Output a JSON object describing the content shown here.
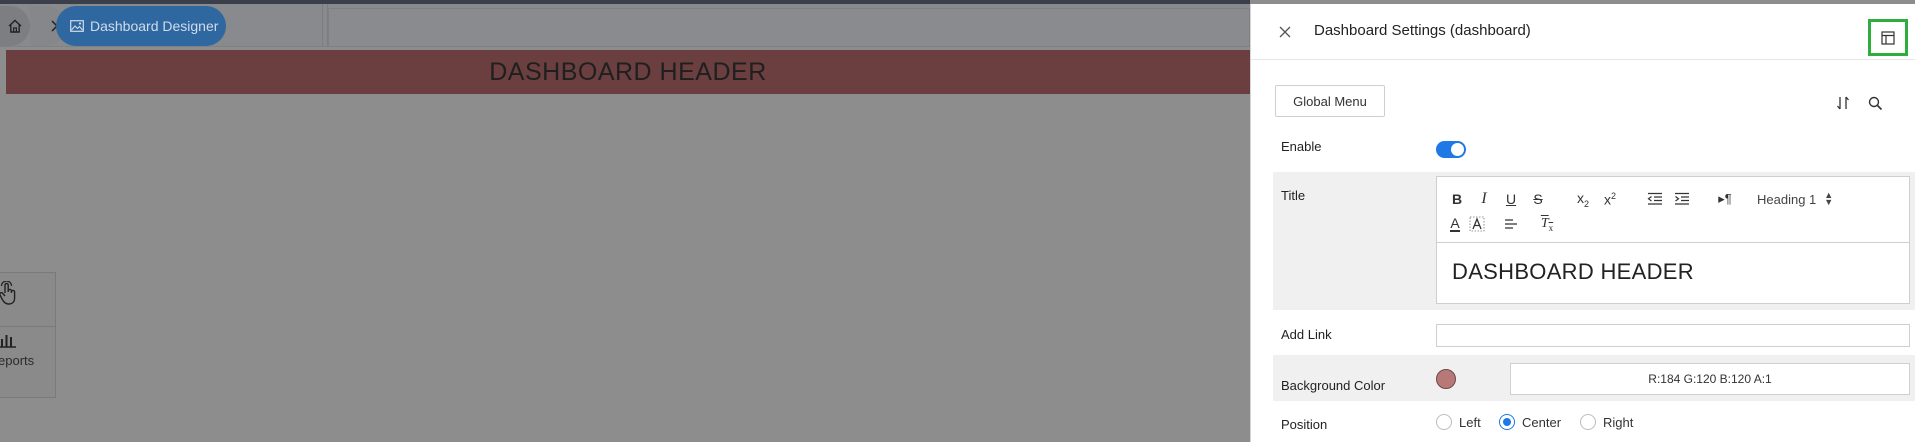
{
  "breadcrumb": {
    "active_label": "Dashboard Designer"
  },
  "dashboard": {
    "header_text": "DASHBOARD HEADER"
  },
  "left_tools": {
    "reports_label": "eports"
  },
  "settings": {
    "title": "Dashboard Settings (dashboard)",
    "global_menu_label": "Global Menu",
    "enable_label": "Enable",
    "enable_on": true,
    "title_label": "Title",
    "editor": {
      "heading_select": "Heading 1",
      "content": "DASHBOARD HEADER"
    },
    "add_link_label": "Add Link",
    "add_link_value": "",
    "background_color_label": "Background Color",
    "background_color_value": "R:184 G:120 B:120 A:1",
    "background_swatch": "#b87878",
    "position_label": "Position",
    "position_options": [
      "Left",
      "Center",
      "Right"
    ],
    "position_selected": "Center"
  },
  "colors": {
    "accent": "#1e78e6",
    "highlight_border": "#2fae3f",
    "breadcrumb_active": "#2f67a0"
  }
}
